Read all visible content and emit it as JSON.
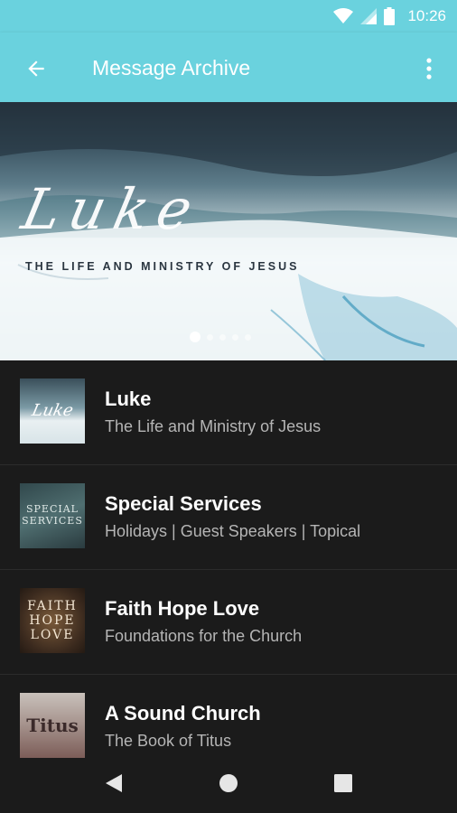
{
  "status": {
    "time": "10:26",
    "icons": [
      "wifi-icon",
      "signal-icon",
      "battery-icon"
    ]
  },
  "appbar": {
    "title": "Message Archive",
    "back_icon": "arrow-left-icon",
    "menu_icon": "more-vert-icon",
    "color": "#6ad2de"
  },
  "hero": {
    "script_title": "Luke",
    "subtitle": "THE LIFE AND MINISTRY OF JESUS",
    "pages": 5,
    "active_page": 1
  },
  "series": [
    {
      "title": "Luke",
      "subtitle": "The Life and Ministry of Jesus",
      "thumb_text": "Luke"
    },
    {
      "title": "Special Services",
      "subtitle": "Holidays | Guest Speakers | Topical",
      "thumb_text": "SPECIAL SERVICES"
    },
    {
      "title": "Faith Hope Love",
      "subtitle": "Foundations for the Church",
      "thumb_text": "FAITH HOPE LOVE"
    },
    {
      "title": "A Sound Church",
      "subtitle": "The Book of Titus",
      "thumb_text": "Titus"
    }
  ],
  "navbar": {
    "icons": [
      "back-triangle-icon",
      "home-circle-icon",
      "recents-square-icon"
    ]
  }
}
